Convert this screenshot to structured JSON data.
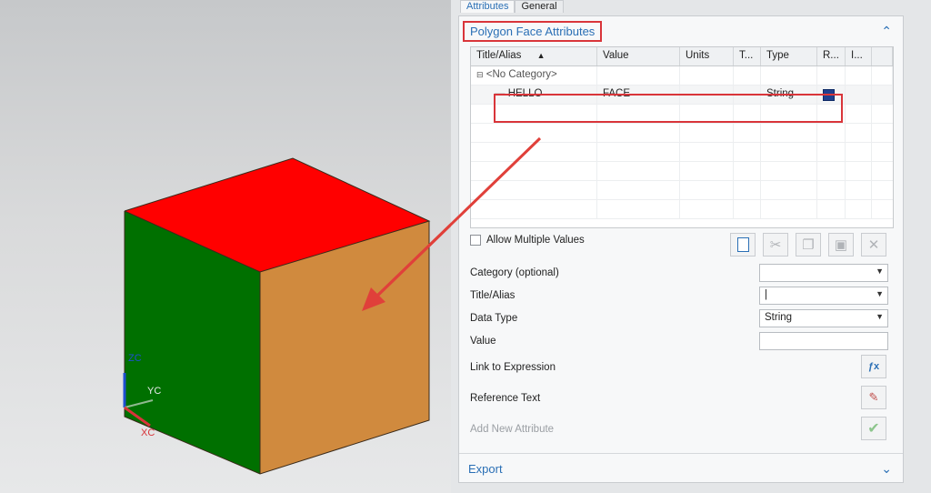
{
  "viewport": {
    "axes": {
      "zc": "ZC",
      "yc": "YC",
      "xc": "XC"
    },
    "colors": {
      "top": "#ff0000",
      "left": "#007000",
      "right": "#d08a3e",
      "arrow": "#e0403a"
    }
  },
  "panel": {
    "tabs": [
      {
        "label": "Attributes"
      },
      {
        "label": "General"
      }
    ],
    "section_title": "Polygon Face Attributes",
    "grid": {
      "columns": [
        "Title/Alias",
        "Value",
        "Units",
        "T...",
        "Type",
        "R...",
        "I..."
      ],
      "category": "<No Category>",
      "rows": [
        {
          "title": "HELLO",
          "value": "FACE",
          "units": "",
          "t": "",
          "type": "String"
        }
      ]
    },
    "allow_multiple_values": "Allow Multiple Values",
    "toolbar_icons": [
      "new-icon",
      "cut-icon",
      "copy-icon",
      "paste-icon",
      "delete-icon"
    ],
    "fields": {
      "category_label": "Category (optional)",
      "category_value": "",
      "title_label": "Title/Alias",
      "title_value": "|",
      "datatype_label": "Data Type",
      "datatype_value": "String",
      "value_label": "Value",
      "link_label": "Link to Expression",
      "reference_label": "Reference Text",
      "add_label": "Add New Attribute"
    },
    "export_label": "Export",
    "accent_color": "#2a6fb5",
    "highlight_color": "#d9353a"
  }
}
